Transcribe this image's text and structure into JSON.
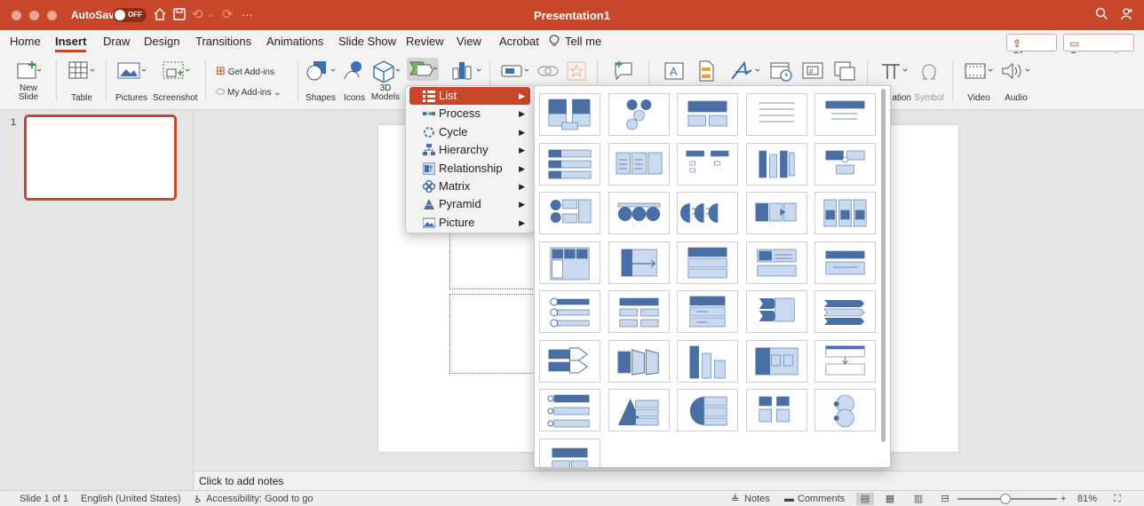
{
  "titlebar": {
    "autosave_label": "AutoSave",
    "autosave_state": "OFF",
    "document_title": "Presentation1",
    "more_label": "···"
  },
  "menu_tabs": [
    {
      "label": "Home",
      "active": false
    },
    {
      "label": "Insert",
      "active": true
    },
    {
      "label": "Draw",
      "active": false
    },
    {
      "label": "Design",
      "active": false
    },
    {
      "label": "Transitions",
      "active": false
    },
    {
      "label": "Animations",
      "active": false
    },
    {
      "label": "Slide Show",
      "active": false
    },
    {
      "label": "Review",
      "active": false
    },
    {
      "label": "View",
      "active": false
    },
    {
      "label": "Acrobat",
      "active": false
    }
  ],
  "tell_me": "Tell me",
  "share_label": "Share",
  "comments_label": "Comments",
  "ribbon": {
    "new_slide": "New\nSlide",
    "table": "Table",
    "pictures": "Pictures",
    "screenshot": "Screenshot",
    "get_addins": "Get Add-ins",
    "my_addins": "My Add-ins ⌄",
    "shapes": "Shapes",
    "icons": "Icons",
    "models_3d": "3D\nModels",
    "equation_partial": "ation",
    "symbol": "Symbol",
    "video": "Video",
    "audio": "Audio"
  },
  "smartart_menu": [
    {
      "label": "List",
      "icon": "list-icon",
      "active": true
    },
    {
      "label": "Process",
      "icon": "process-icon",
      "active": false
    },
    {
      "label": "Cycle",
      "icon": "cycle-icon",
      "active": false
    },
    {
      "label": "Hierarchy",
      "icon": "hierarchy-icon",
      "active": false
    },
    {
      "label": "Relationship",
      "icon": "relationship-icon",
      "active": false
    },
    {
      "label": "Matrix",
      "icon": "matrix-icon",
      "active": false
    },
    {
      "label": "Pyramid",
      "icon": "pyramid-icon",
      "active": false
    },
    {
      "label": "Picture",
      "icon": "picture-icon",
      "active": false
    }
  ],
  "gallery_count": 36,
  "thumbnail_number": "1",
  "notes_placeholder": "Click to add notes",
  "statusbar": {
    "slide_info": "Slide 1 of 1",
    "language": "English (United States)",
    "accessibility": "Accessibility: Good to go",
    "notes": "Notes",
    "comments": "Comments",
    "zoom": "81%"
  },
  "colors": {
    "accent": "#c8472b",
    "smartart_dark": "#4a6fa5",
    "smartart_light": "#c9daf0"
  }
}
